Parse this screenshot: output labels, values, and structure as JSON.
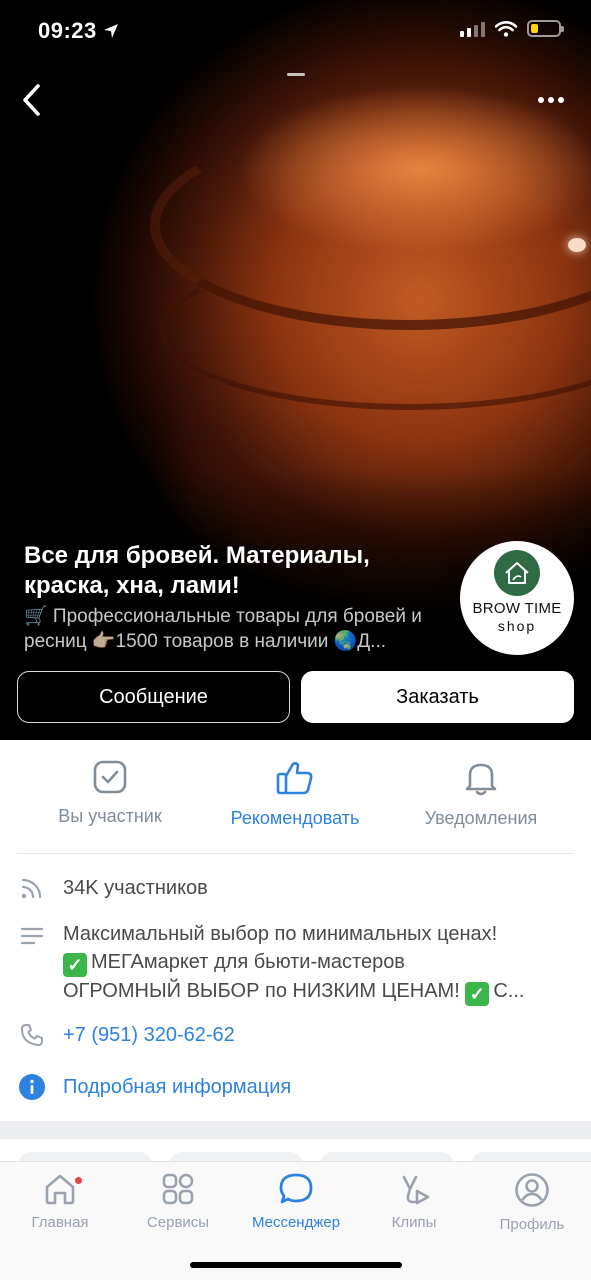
{
  "status_bar": {
    "time": "09:23",
    "battery_level": 0.25,
    "battery_color": "#ffd60a"
  },
  "header": {
    "back_icon": "chevron-left-icon",
    "more_icon": "more-horizontal-icon"
  },
  "group": {
    "title": "Все для бровей. Материалы, краска, хна, лами!",
    "subtitle": "🛒 Профессиональные товары для бровей и ресниц 👉🏻1500 товаров в наличии 🌏Д...",
    "avatar_brand": "BROW TIME",
    "avatar_sub": "shop",
    "avatar_color": "#2e6b45"
  },
  "buttons": {
    "message": "Сообщение",
    "order": "Заказать"
  },
  "actions": [
    {
      "label": "Вы участник",
      "icon": "checkbox-icon"
    },
    {
      "label": "Рекомендовать",
      "icon": "thumbs-up-icon",
      "active": true
    },
    {
      "label": "Уведомления",
      "icon": "bell-icon"
    }
  ],
  "info": {
    "members": "34K участников",
    "description": {
      "line1": "Максимальный выбор по минимальных ценах!",
      "line2": "МЕГАмаркет для бьюти-мастеров",
      "line3": "ОГРОМНЫЙ ВЫБОР по НИЗКИМ ЦЕНАМ! ",
      "line3_tail": "С..."
    },
    "phone": "+7 (951) 320-62-62",
    "details_link": "Подробная информация"
  },
  "tabbar": {
    "items": [
      {
        "label": "Главная",
        "icon": "home-icon",
        "badge": true
      },
      {
        "label": "Сервисы",
        "icon": "services-grid-icon"
      },
      {
        "label": "Мессенджер",
        "icon": "chat-bubble-icon",
        "active": true
      },
      {
        "label": "Клипы",
        "icon": "clips-icon"
      },
      {
        "label": "Профиль",
        "icon": "profile-icon"
      }
    ]
  },
  "colors": {
    "accent": "#2d81e0",
    "secondary_text": "#818c99",
    "badge": "#e64646"
  }
}
